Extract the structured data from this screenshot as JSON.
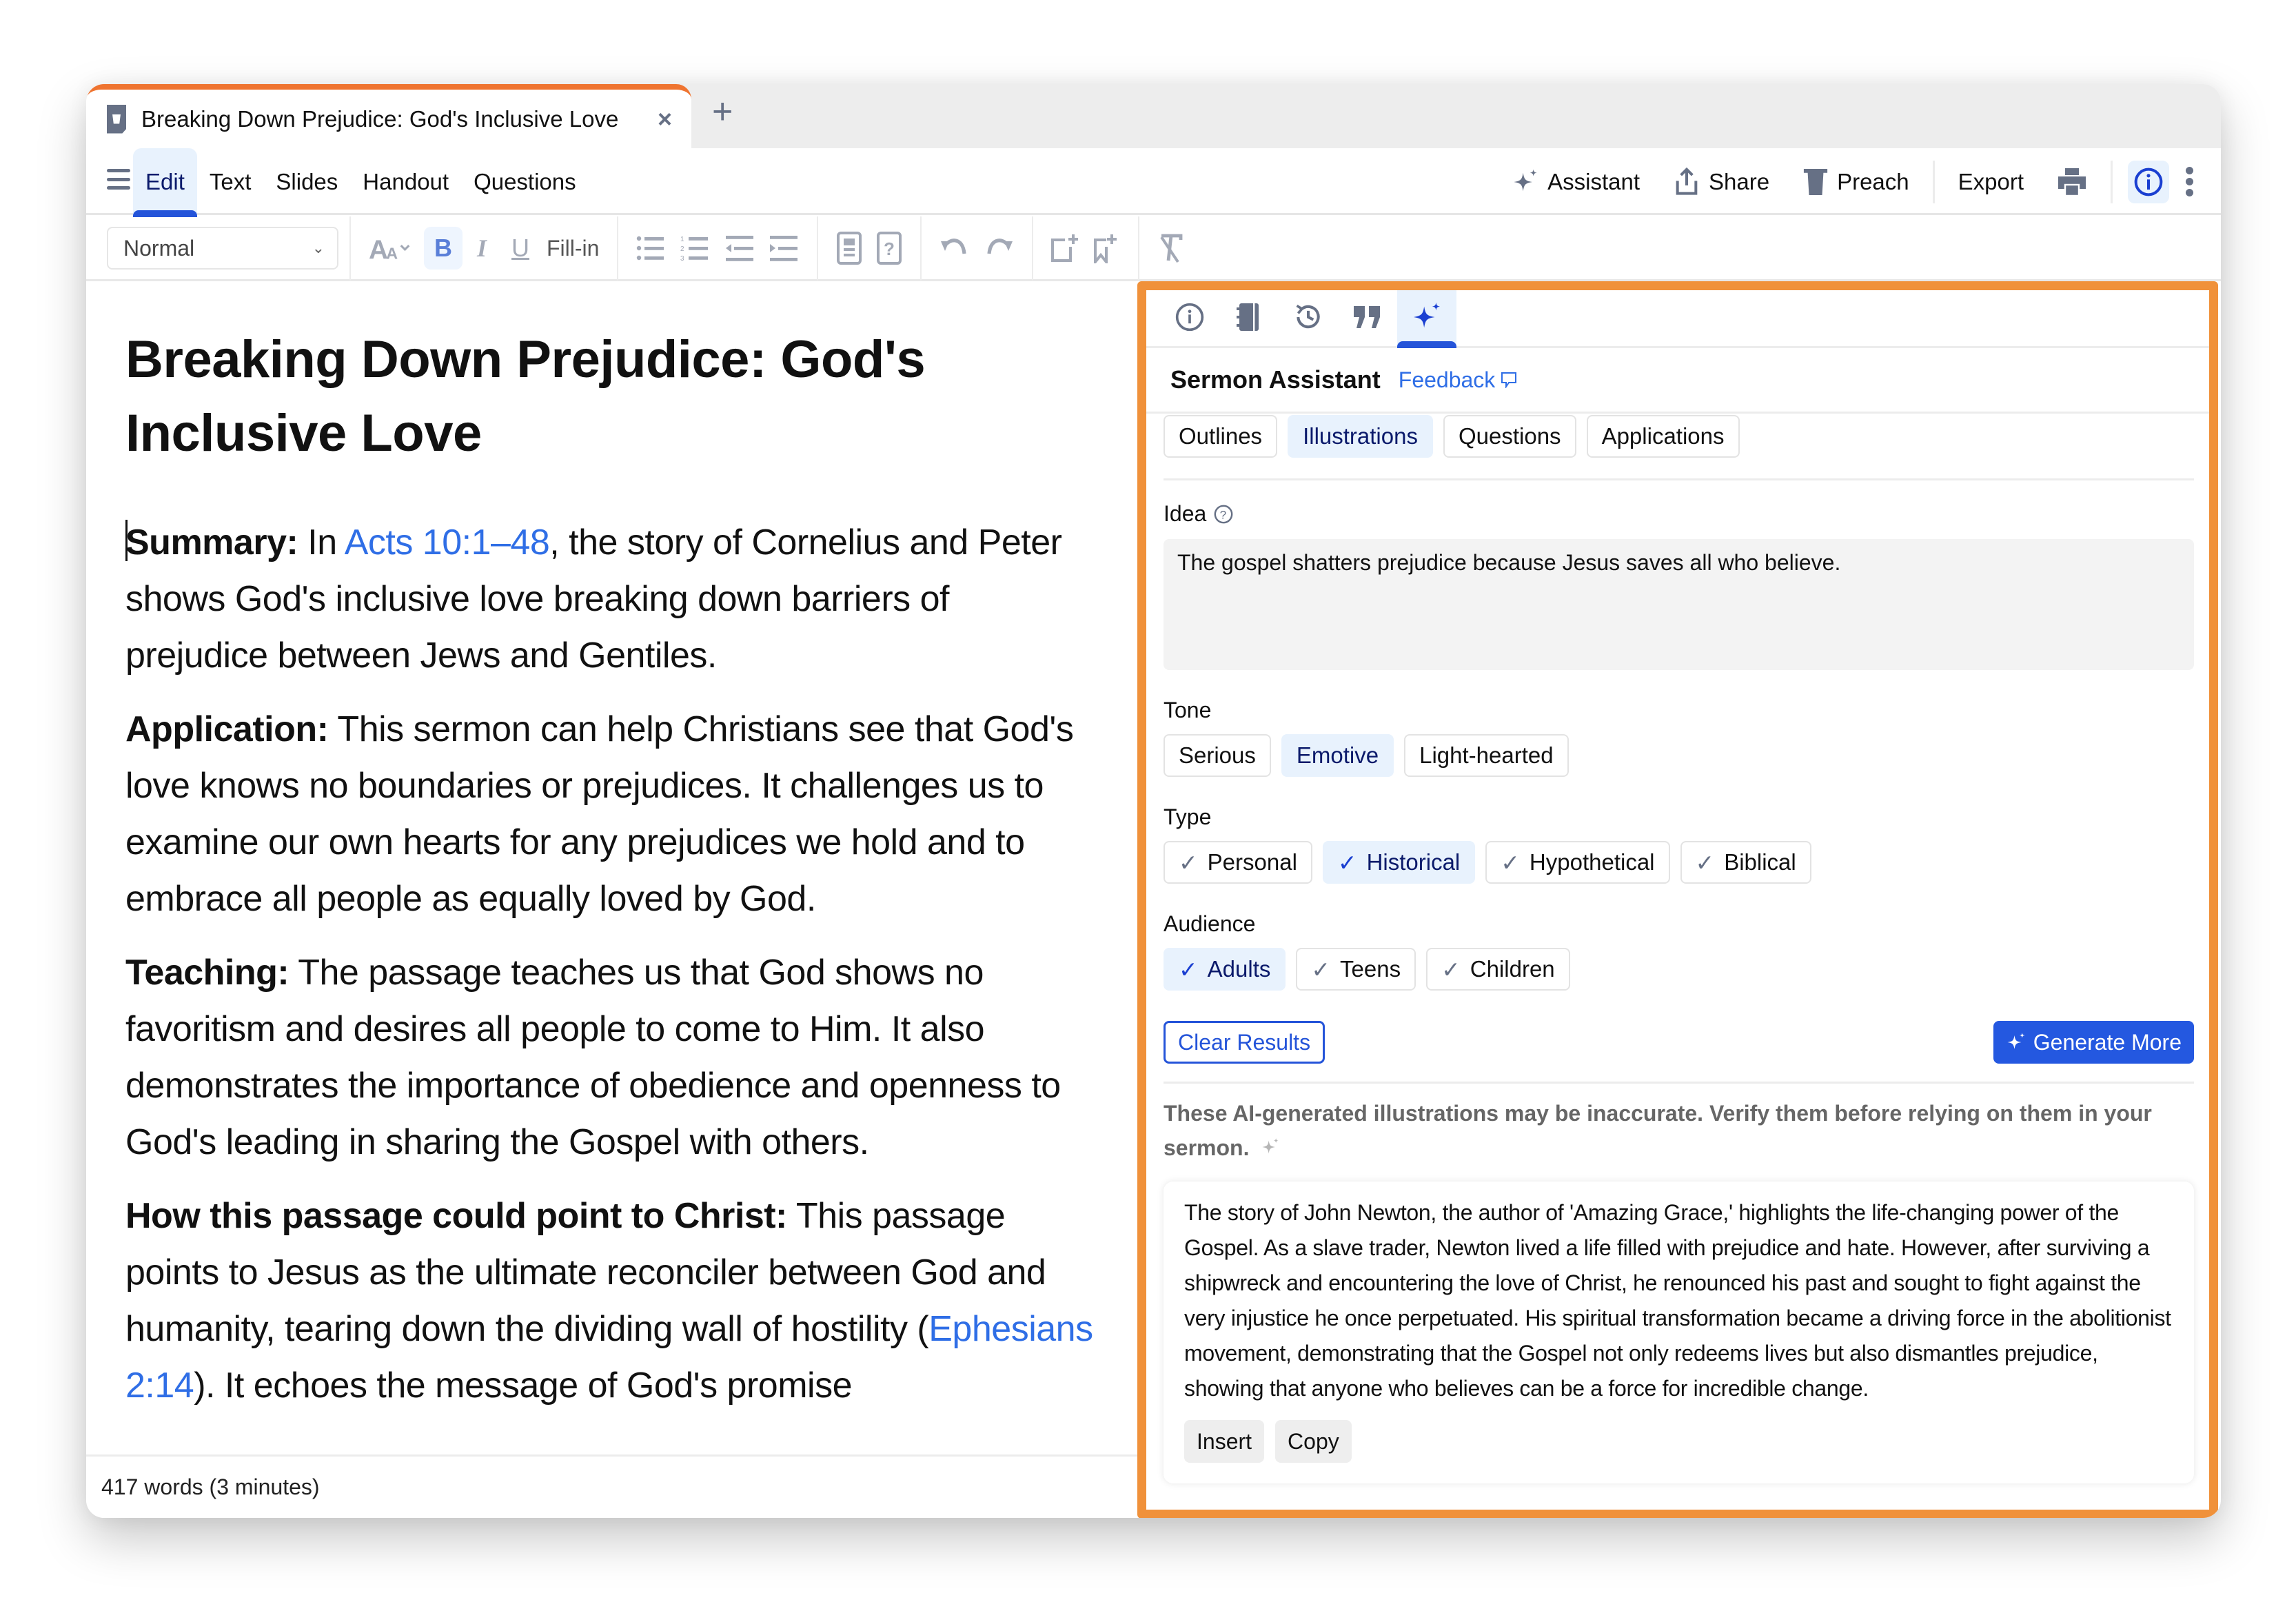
{
  "colors": {
    "accent_orange": "#ef7430",
    "panel_highlight": "#f0913a",
    "primary_blue": "#2458e0",
    "link_blue": "#2f6ee6",
    "icon_gray": "#667085",
    "selected_bg": "#e8f2fd"
  },
  "tab": {
    "title": "Breaking Down Prejudice: God's Inclusive Love",
    "icon": "document-cup-icon",
    "close_label": "×",
    "new_tab_label": "+"
  },
  "menu": {
    "items": [
      {
        "label": "Edit",
        "active": true
      },
      {
        "label": "Text",
        "active": false
      },
      {
        "label": "Slides",
        "active": false
      },
      {
        "label": "Handout",
        "active": false
      },
      {
        "label": "Questions",
        "active": false
      }
    ],
    "actions": {
      "assistant": "Assistant",
      "share": "Share",
      "preach": "Preach",
      "export": "Export"
    }
  },
  "toolbar": {
    "style_select": "Normal",
    "fill_in": "Fill-in",
    "bold": "B",
    "italic": "I",
    "underline": "U"
  },
  "document": {
    "title": "Breaking Down Prejudice: God's Inclusive Love",
    "sections": [
      {
        "label": "Summary:",
        "pre": " In ",
        "link": "Acts 10:1–48",
        "post": ", the story of Cornelius and Peter shows God's inclusive love breaking down barriers of prejudice between Jews and Gentiles."
      },
      {
        "label": "Application:",
        "text": " This sermon can help Christians see that God's love knows no boundaries or prejudices. It challenges us to examine our own hearts for any prejudices we hold and to embrace all people as equally loved by God."
      },
      {
        "label": "Teaching:",
        "text": " The passage teaches us that God shows no favoritism and desires all people to come to Him. It also demonstrates the importance of obedience and openness to God's leading in sharing the Gospel with others."
      },
      {
        "label": "How this passage could point to Christ:",
        "pre": " This passage points to Jesus as the ultimate reconciler between God and humanity, tearing down the dividing wall of hostility (",
        "link": "Ephesians 2:14",
        "post": "). It echoes the message of God's promise"
      }
    ],
    "word_count": "417 words (3 minutes)"
  },
  "panel": {
    "tabs": [
      {
        "name": "info",
        "active": false
      },
      {
        "name": "notebook",
        "active": false
      },
      {
        "name": "history",
        "active": false
      },
      {
        "name": "quotes",
        "active": false
      },
      {
        "name": "assistant",
        "active": true
      }
    ],
    "title": "Sermon Assistant",
    "feedback": "Feedback",
    "categories": [
      {
        "label": "Outlines",
        "selected": false
      },
      {
        "label": "Illustrations",
        "selected": true
      },
      {
        "label": "Questions",
        "selected": false
      },
      {
        "label": "Applications",
        "selected": false
      }
    ],
    "idea_label": "Idea",
    "idea_value": "The gospel shatters prejudice because Jesus saves all who believe.",
    "tone_label": "Tone",
    "tones": [
      {
        "label": "Serious",
        "selected": false
      },
      {
        "label": "Emotive",
        "selected": true
      },
      {
        "label": "Light-hearted",
        "selected": false
      }
    ],
    "type_label": "Type",
    "types": [
      {
        "label": "Personal",
        "selected": false
      },
      {
        "label": "Historical",
        "selected": true
      },
      {
        "label": "Hypothetical",
        "selected": false
      },
      {
        "label": "Biblical",
        "selected": false
      }
    ],
    "audience_label": "Audience",
    "audiences": [
      {
        "label": "Adults",
        "selected": true
      },
      {
        "label": "Teens",
        "selected": false
      },
      {
        "label": "Children",
        "selected": false
      }
    ],
    "clear_results": "Clear Results",
    "generate_more": "Generate More",
    "disclaimer": "These AI-generated illustrations may be inaccurate. Verify them before relying on them in your sermon.",
    "results": [
      {
        "text": "The story of John Newton, the author of 'Amazing Grace,' highlights the life-changing power of the Gospel. As a slave trader, Newton lived a life filled with prejudice and hate. However, after surviving a shipwreck and encountering the love of Christ, he renounced his past and sought to fight against the very injustice he once perpetuated. His spiritual transformation became a driving force in the abolitionist movement, demonstrating that the Gospel not only redeems lives but also dismantles prejudice, showing that anyone who believes can be a force for incredible change.",
        "insert": "Insert",
        "copy": "Copy"
      }
    ]
  }
}
